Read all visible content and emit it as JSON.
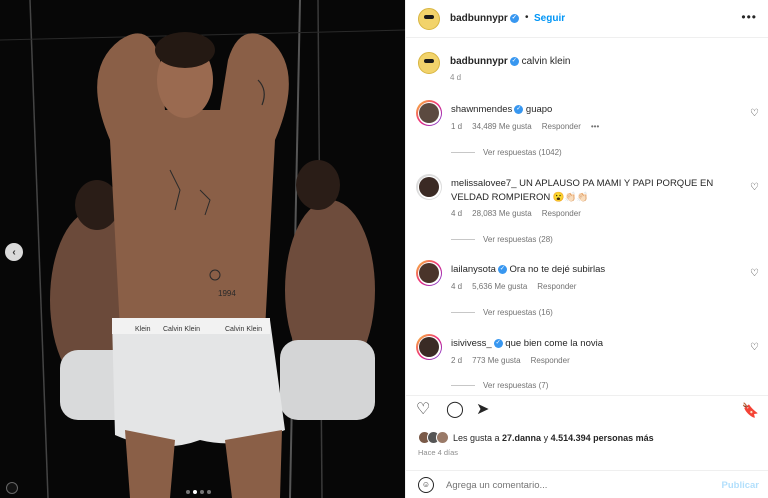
{
  "post": {
    "username": "badbunnypr",
    "separator": "•",
    "follow_label": "Seguir",
    "more_label": "•••",
    "caption": "calvin klein",
    "caption_time": "4 d",
    "carousel": {
      "total": 4,
      "active": 2
    },
    "prev_arrow": "‹"
  },
  "comments": [
    {
      "user": "shawnmendes",
      "verified": true,
      "text": "guapo",
      "time": "1 d",
      "likes": "34,489 Me gusta",
      "reply_label": "Responder",
      "extra": "•••",
      "replies": "Ver respuestas (1042)"
    },
    {
      "user": "melissalovee7_",
      "verified": false,
      "text": "UN APLAUSO PA MAMI Y PAPI PORQUE EN VELDAD ROMPIERON 😮👏🏻👏🏻",
      "time": "4 d",
      "likes": "28,083 Me gusta",
      "reply_label": "Responder",
      "extra": "",
      "replies": "Ver respuestas (28)"
    },
    {
      "user": "lailanysota",
      "verified": true,
      "text": "Ora no te dejé subirlas",
      "time": "4 d",
      "likes": "5,636 Me gusta",
      "reply_label": "Responder",
      "extra": "",
      "replies": "Ver respuestas (16)"
    },
    {
      "user": "isivivess_",
      "verified": true,
      "text": "que bien come la novia",
      "time": "2 d",
      "likes": "773 Me gusta",
      "reply_label": "Responder",
      "extra": "",
      "replies": "Ver respuestas (7)"
    }
  ],
  "actions": {
    "like_icon": "♡",
    "comment_icon": "◯",
    "share_icon": "➤",
    "save_icon": "🔖"
  },
  "likes": {
    "prefix": "Les gusta a ",
    "user": "27.danna",
    "middle": " y ",
    "count": "4.514.394 personas más"
  },
  "posted_ago": "Hace 4 días",
  "add_comment": {
    "placeholder": "Agrega un comentario...",
    "publish_label": "Publicar",
    "emoji_icon": "☺"
  },
  "image_text": {
    "waistband_left": "Calvin Klein",
    "waistband_right": "Calvin Klein",
    "waistband_side": "Klein",
    "tattoo_number": "1994"
  },
  "colors": {
    "accent": "#0095f6",
    "verified": "#3897f0",
    "text": "#262626",
    "muted": "#8e8e8e"
  }
}
